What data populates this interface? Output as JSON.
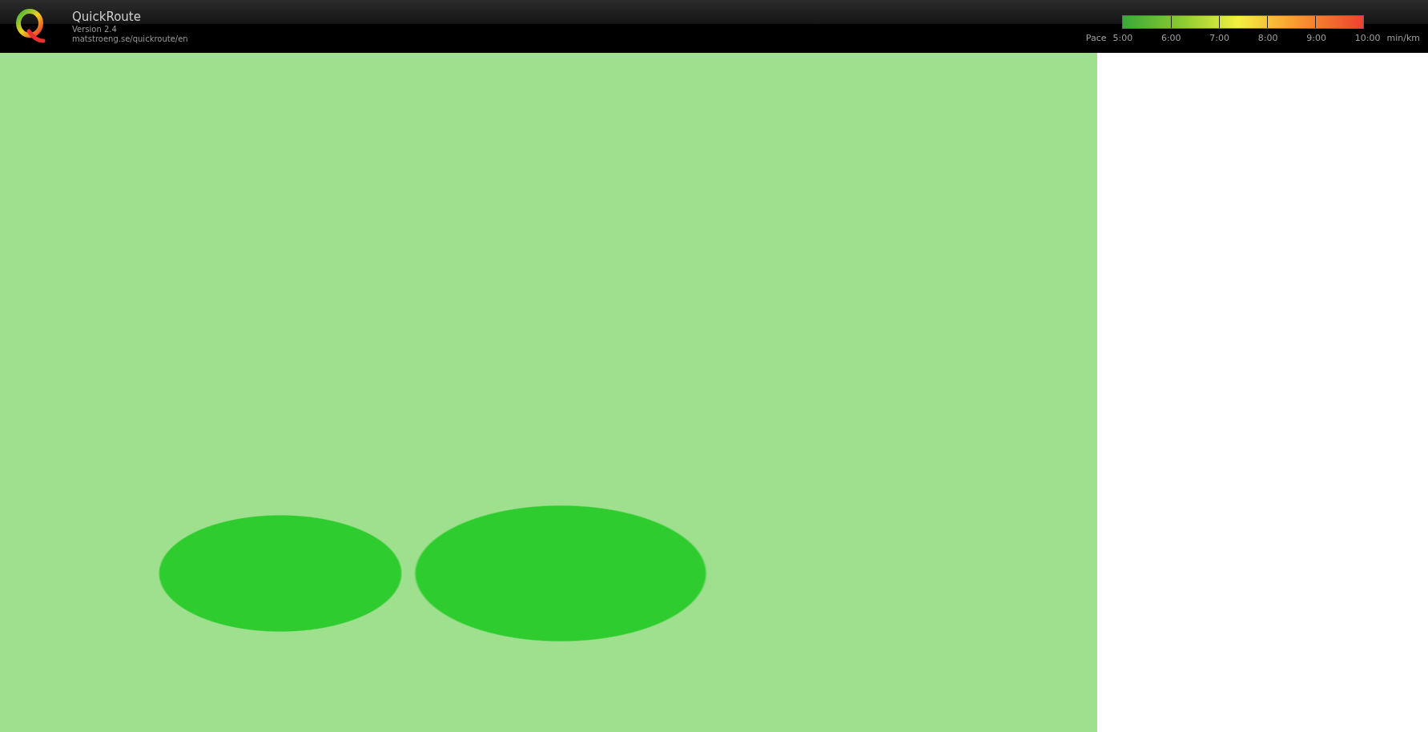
{
  "app": {
    "title": "QuickRoute",
    "version": "Version 2.4",
    "url": "matstroeng.se/quickroute/en"
  },
  "pace_scale": {
    "label": "Pace",
    "ticks": [
      "5:00",
      "6:00",
      "7:00",
      "8:00",
      "9:00",
      "10:00"
    ],
    "unit": "min/km"
  }
}
